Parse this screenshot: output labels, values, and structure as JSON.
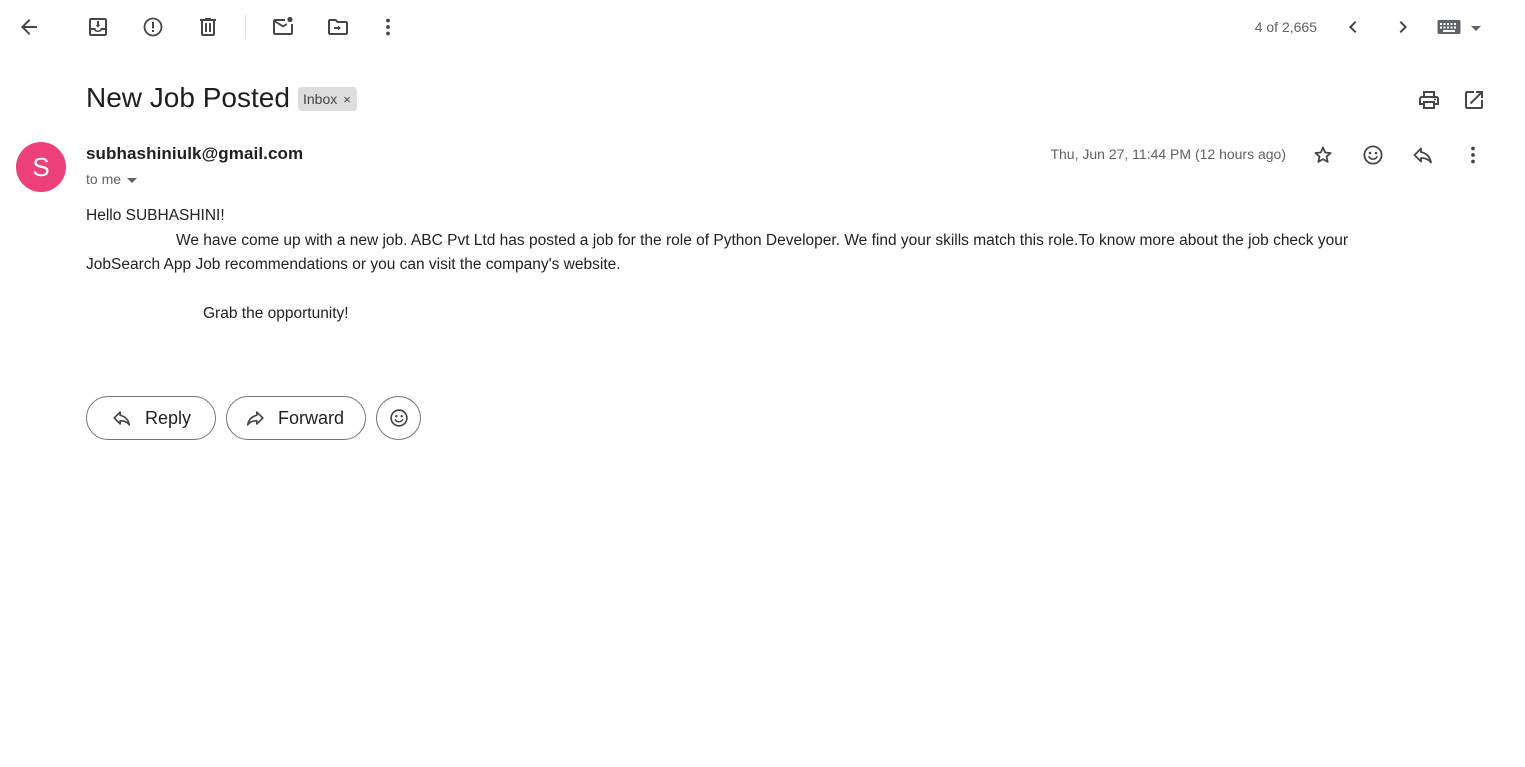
{
  "toolbar": {
    "icons": [
      "back-arrow-icon",
      "archive-icon",
      "report-spam-icon",
      "delete-icon",
      "mark-unread-icon",
      "move-to-icon",
      "more-vert-icon"
    ],
    "counter": "4 of 2,665",
    "nav_icons": [
      "chevron-left-icon",
      "chevron-right-icon",
      "keyboard-icon"
    ]
  },
  "header": {
    "subject": "New Job Posted",
    "label_chip": "Inbox",
    "label_chip_close": "×",
    "actions": [
      "print-icon",
      "open-in-new-window-icon"
    ]
  },
  "message": {
    "avatar_letter": "S",
    "avatar_color": "#ec407a",
    "sender": "subhashiniulk@gmail.com",
    "recipient": "to me",
    "date": "Thu, Jun 27, 11:44 PM (12 hours ago)",
    "actions": [
      "star-icon",
      "emoji-icon",
      "reply-icon",
      "more-vert-icon"
    ],
    "body": {
      "greeting": "Hello SUBHASHINI!",
      "paragraph": "We have come up with a new job. ABC Pvt Ltd has posted a job for the role of Python Developer. We find your skills match this role.To know more about the job check your JobSearch App Job recommendations or you can visit the company's website.",
      "closing": "Grab the opportunity!"
    }
  },
  "footer": {
    "reply_label": "Reply",
    "forward_label": "Forward"
  }
}
